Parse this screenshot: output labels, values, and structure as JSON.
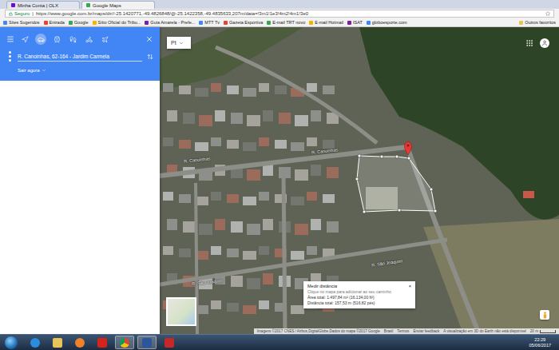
{
  "browser": {
    "tabs": [
      {
        "label": "Minha Conta | OLX",
        "selected": false
      },
      {
        "label": "Google Maps",
        "selected": true
      }
    ],
    "secure_label": "Seguro",
    "url": "https://www.google.com.br/maps/dir//-25.1420771,-49.4826848/@-25.1422358,-49.4835633,207m/data=!3m1!1e3!4m2!4m1!3e0",
    "bookmarks": [
      "Sites Sugeridos",
      "Entrada",
      "Google",
      "Sítio Oficial do Tribu...",
      "Guia Amarela - Prefe...",
      "MTT Tv",
      "Gazeta Esportiva",
      "E-mail TRT novo",
      "E-mail Hotmail",
      "ISAT",
      "globoesporte.com"
    ],
    "other_bookmarks": "Outros favoritos"
  },
  "sidebar": {
    "modes": [
      {
        "kind": "best",
        "selected": false
      },
      {
        "kind": "car",
        "selected": true
      },
      {
        "kind": "transit",
        "selected": false
      },
      {
        "kind": "walk",
        "selected": false
      },
      {
        "kind": "bike",
        "selected": false
      },
      {
        "kind": "flight",
        "selected": false
      }
    ],
    "destination": "R. Canoinhas, 62-164 - Jardim Carmela",
    "leave_option": "Sair agora"
  },
  "map": {
    "layer_label": "Pt",
    "street_labels": [
      "R. Canoinhas",
      "R. Canoinhas",
      "R. São Joaquim",
      "R. São Joaquim"
    ],
    "measure": {
      "title": "Medir distância",
      "close": "×",
      "hint": "Clique no mapa para adicionar ao seu caminho",
      "area": "Área total: 1.497,84 m² (16.134,00 ft²)",
      "distance": "Distância total: 157,53 m (516,82 pés)"
    },
    "attribution": [
      "Imagens ©2017 CNES / Airbus,DigitalGlobe,Dados do mapa ©2017 Google",
      "Brasil",
      "Termos",
      "Enviar feedback"
    ],
    "notice": "A visualização em 3D do Earth não está disponível",
    "scale": "20 m"
  },
  "taskbar": {
    "apps": [
      {
        "kind": "ie",
        "selected": false
      },
      {
        "kind": "explorer",
        "selected": false
      },
      {
        "kind": "media",
        "selected": false
      },
      {
        "kind": "pdf",
        "selected": false
      },
      {
        "kind": "chrome",
        "selected": true
      },
      {
        "kind": "word",
        "selected": true
      },
      {
        "kind": "paint",
        "selected": false
      }
    ],
    "time": "22:29",
    "date": "05/06/2017"
  }
}
